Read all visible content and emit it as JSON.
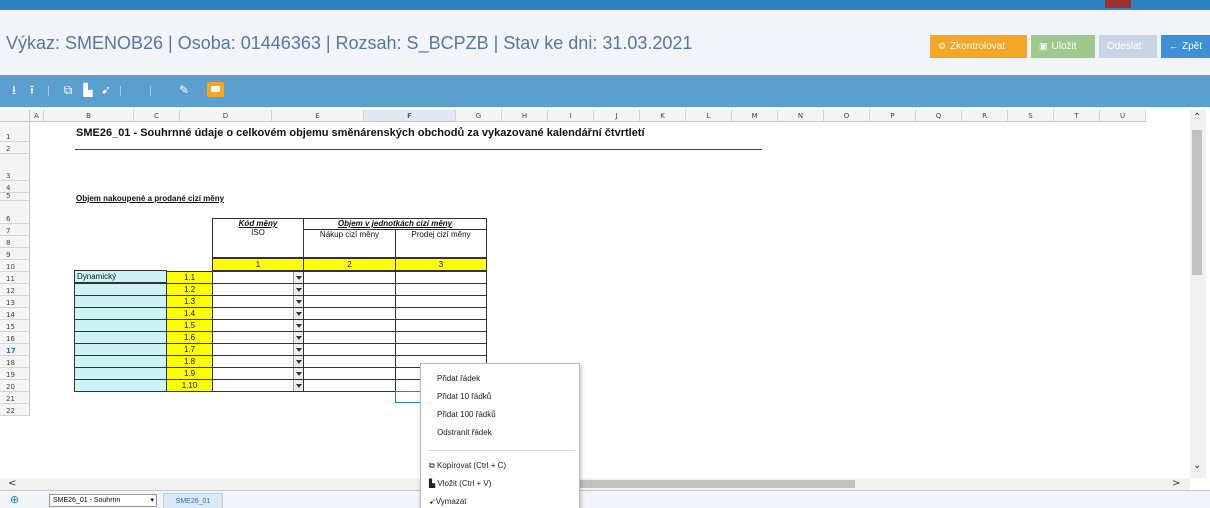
{
  "header": {
    "title": "Výkaz: SMENOB26 | Osoba: 01446363 | Rozsah: S_BCPZB | Stav ke dni: 31.03.2021",
    "buttons": {
      "check": "Zkontrolovat",
      "save": "Uložit",
      "send": "Odeslat",
      "back": "Zpět"
    },
    "colors": {
      "check": "#f5a623",
      "save": "#9fc98b",
      "send": "#c8d6e6",
      "back": "#3d8fd6"
    }
  },
  "grid": {
    "columns": [
      "A",
      "B",
      "C",
      "D",
      "E",
      "F",
      "G",
      "H",
      "I",
      "J",
      "K",
      "L",
      "M",
      "N",
      "O",
      "P",
      "Q",
      "R",
      "S",
      "T",
      "U"
    ],
    "selected_column": "F",
    "rows": [
      "1",
      "2",
      "3",
      "4",
      "5",
      "6",
      "7",
      "8",
      "9",
      "10",
      "11",
      "12",
      "13",
      "14",
      "15",
      "16",
      "17",
      "18",
      "19",
      "20",
      "21",
      "22"
    ],
    "selected_row": "17"
  },
  "sheet": {
    "title": "SME26_01 - Souhrnné údaje o celkovém objemu směnárenských obchodů za vykazované kalendářní čtvrtletí",
    "subtitle": "Objem nakoupené a prodané cizí měny",
    "header_kod": "Kód měny",
    "header_iso": "ISO",
    "header_objem": "Objem v jednotkách cizí měny",
    "header_nakup": "Nákup cizí měny",
    "header_prodej": "Prodej cizí měny",
    "col_numbers": [
      "1",
      "2",
      "3"
    ],
    "row_label": "Dynamický",
    "row_codes": [
      "1.1",
      "1.2",
      "1.3",
      "1.4",
      "1.5",
      "1.6",
      "1.7",
      "1.8",
      "1.9",
      "1.10"
    ]
  },
  "context_menu": {
    "add_row": "Přidat řádek",
    "add_10": "Přidat 10 řádků",
    "add_100": "Přidat 100 řádků",
    "remove_row": "Odstranit řádek",
    "copy": "Kopírovat (Ctrl + C)",
    "paste": "Vložit (Ctrl + V)",
    "delete": "Vymazat"
  },
  "bottom": {
    "sheet_select": "SME26_01 - Souhrnn",
    "sheet_tab": "SME26_01"
  }
}
